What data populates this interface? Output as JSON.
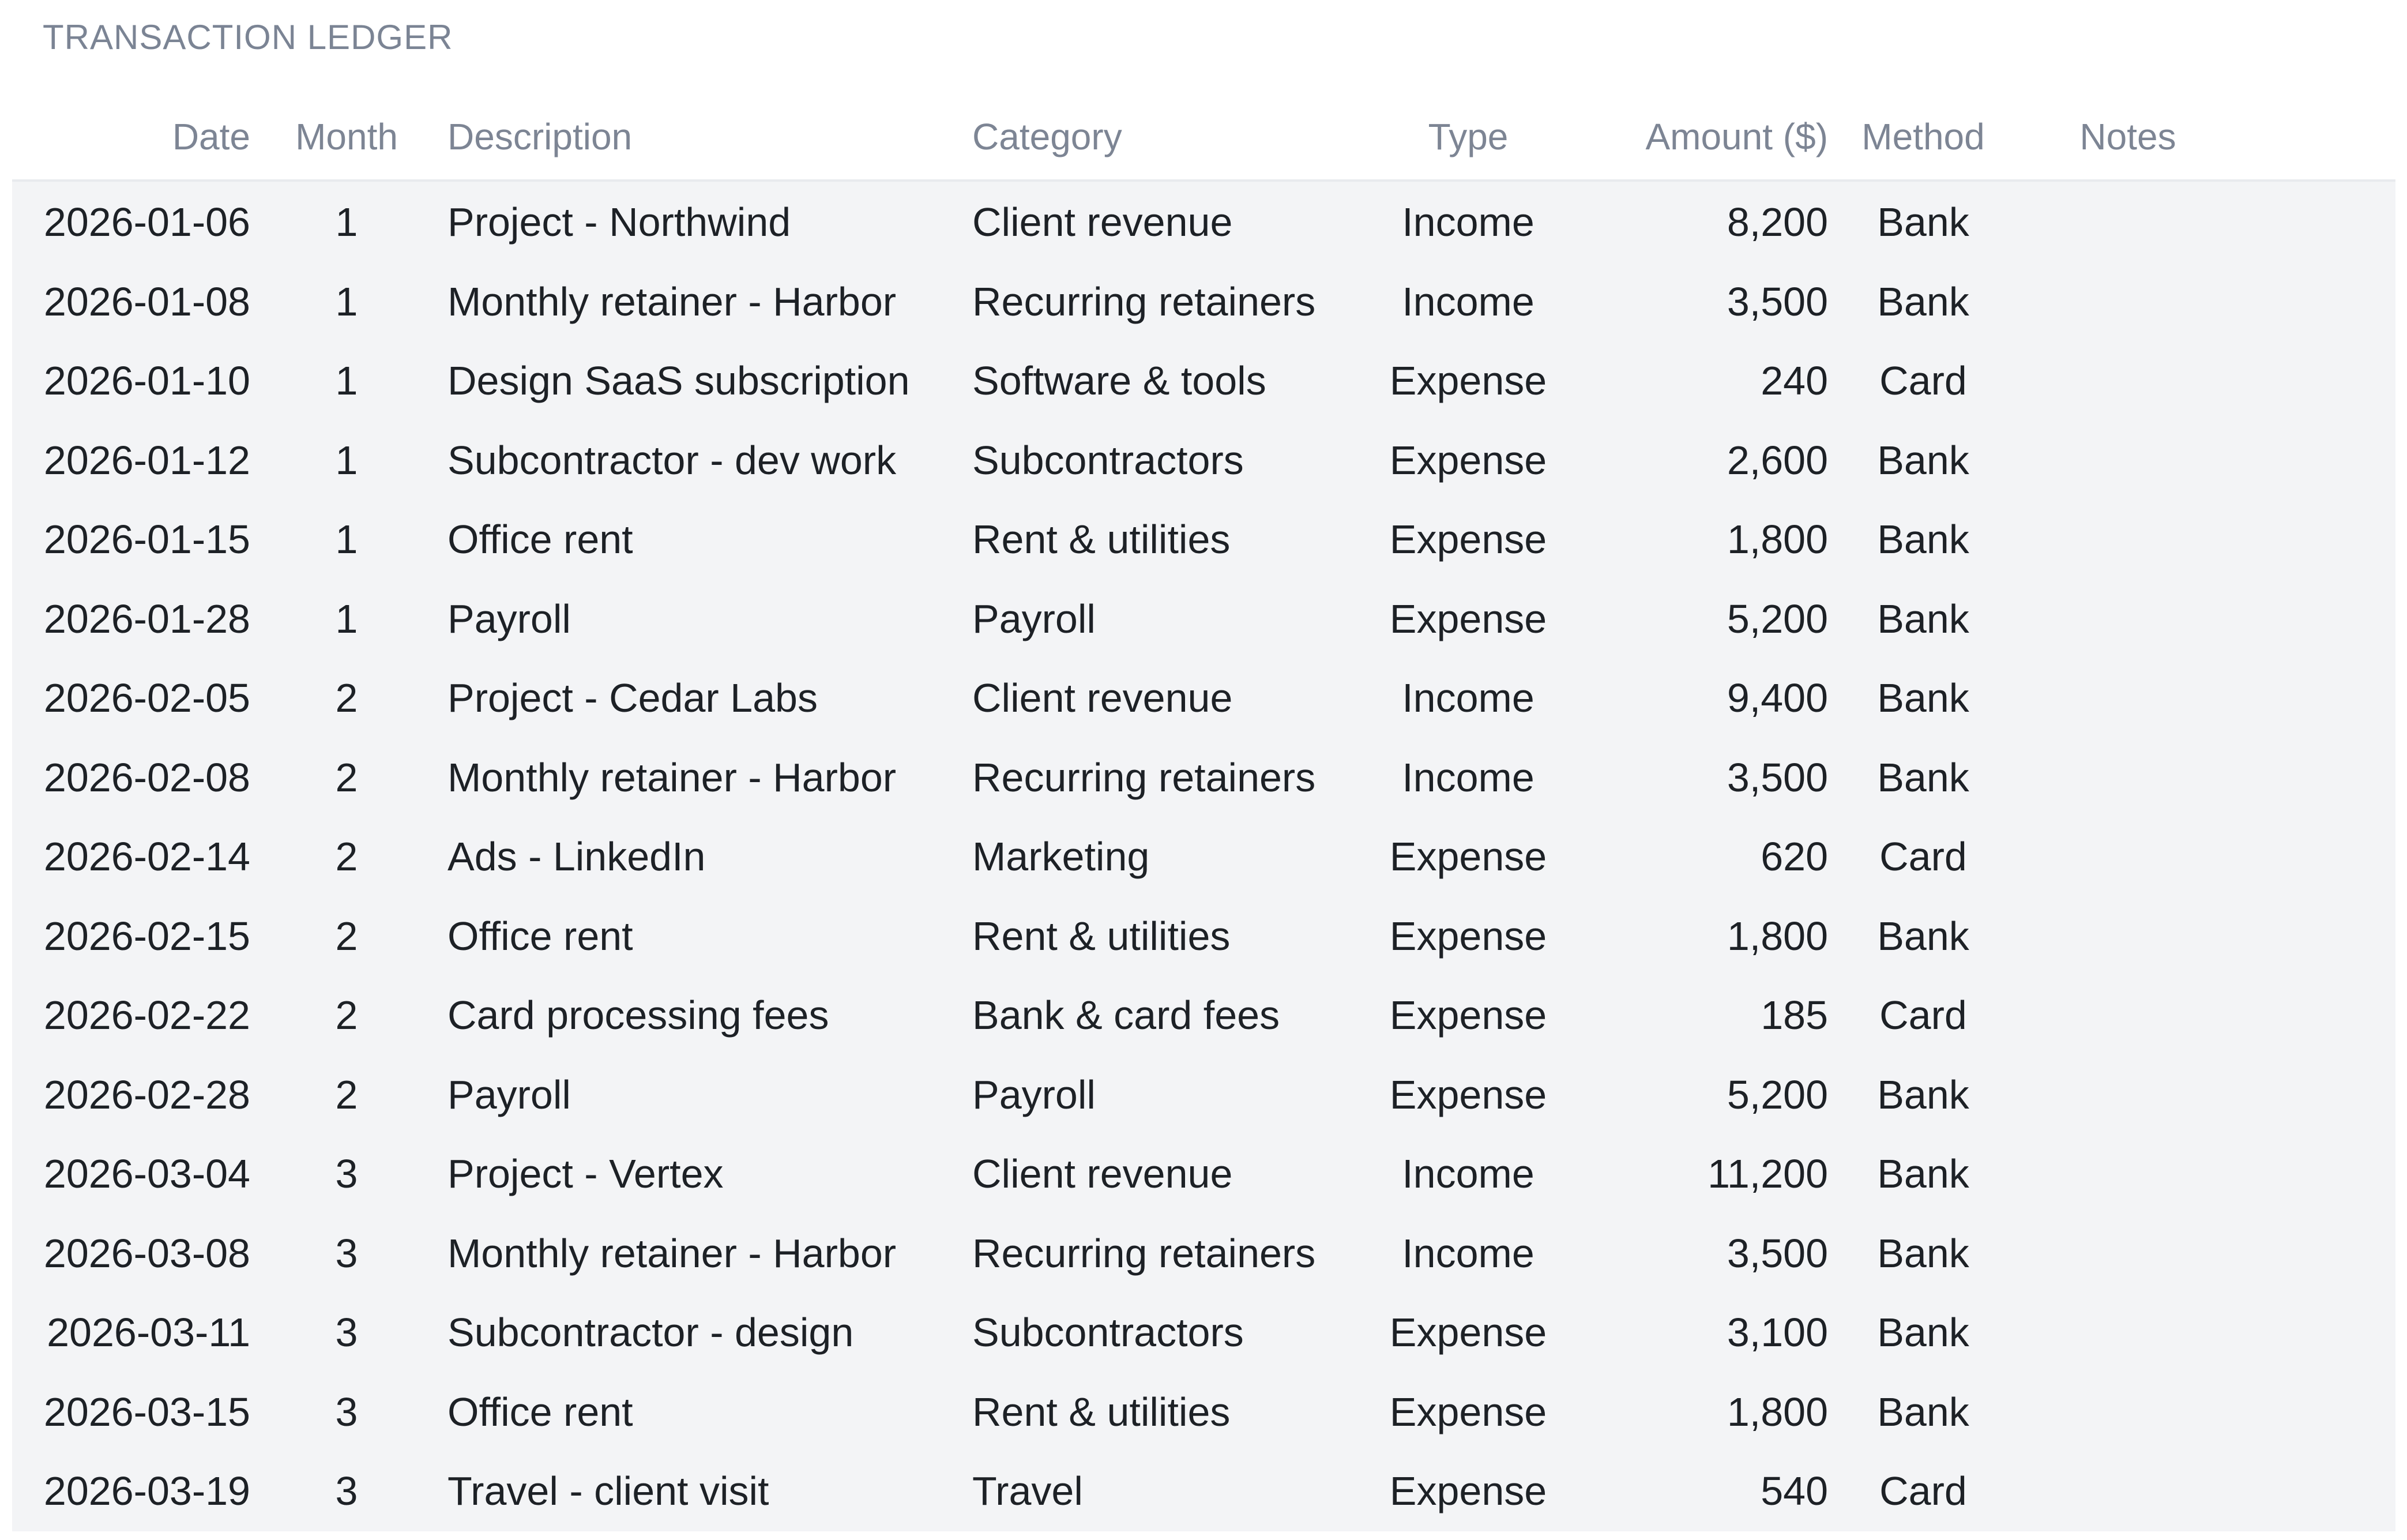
{
  "sheet": {
    "title": "TRANSACTION LEDGER"
  },
  "columns": {
    "date": "Date",
    "month": "Month",
    "description": "Description",
    "category": "Category",
    "type": "Type",
    "amount": "Amount ($)",
    "method": "Method",
    "notes": "Notes"
  },
  "rows": [
    {
      "date": "2026-01-06",
      "month": "1",
      "description": "Project - Northwind",
      "category": "Client revenue",
      "type": "Income",
      "amount": "8,200",
      "method": "Bank",
      "notes": ""
    },
    {
      "date": "2026-01-08",
      "month": "1",
      "description": "Monthly retainer - Harbor",
      "category": "Recurring retainers",
      "type": "Income",
      "amount": "3,500",
      "method": "Bank",
      "notes": ""
    },
    {
      "date": "2026-01-10",
      "month": "1",
      "description": "Design SaaS subscription",
      "category": "Software & tools",
      "type": "Expense",
      "amount": "240",
      "method": "Card",
      "notes": ""
    },
    {
      "date": "2026-01-12",
      "month": "1",
      "description": "Subcontractor - dev work",
      "category": "Subcontractors",
      "type": "Expense",
      "amount": "2,600",
      "method": "Bank",
      "notes": ""
    },
    {
      "date": "2026-01-15",
      "month": "1",
      "description": "Office rent",
      "category": "Rent & utilities",
      "type": "Expense",
      "amount": "1,800",
      "method": "Bank",
      "notes": ""
    },
    {
      "date": "2026-01-28",
      "month": "1",
      "description": "Payroll",
      "category": "Payroll",
      "type": "Expense",
      "amount": "5,200",
      "method": "Bank",
      "notes": ""
    },
    {
      "date": "2026-02-05",
      "month": "2",
      "description": "Project - Cedar Labs",
      "category": "Client revenue",
      "type": "Income",
      "amount": "9,400",
      "method": "Bank",
      "notes": ""
    },
    {
      "date": "2026-02-08",
      "month": "2",
      "description": "Monthly retainer - Harbor",
      "category": "Recurring retainers",
      "type": "Income",
      "amount": "3,500",
      "method": "Bank",
      "notes": ""
    },
    {
      "date": "2026-02-14",
      "month": "2",
      "description": "Ads - LinkedIn",
      "category": "Marketing",
      "type": "Expense",
      "amount": "620",
      "method": "Card",
      "notes": ""
    },
    {
      "date": "2026-02-15",
      "month": "2",
      "description": "Office rent",
      "category": "Rent & utilities",
      "type": "Expense",
      "amount": "1,800",
      "method": "Bank",
      "notes": ""
    },
    {
      "date": "2026-02-22",
      "month": "2",
      "description": "Card processing fees",
      "category": "Bank & card fees",
      "type": "Expense",
      "amount": "185",
      "method": "Card",
      "notes": ""
    },
    {
      "date": "2026-02-28",
      "month": "2",
      "description": "Payroll",
      "category": "Payroll",
      "type": "Expense",
      "amount": "5,200",
      "method": "Bank",
      "notes": ""
    },
    {
      "date": "2026-03-04",
      "month": "3",
      "description": "Project - Vertex",
      "category": "Client revenue",
      "type": "Income",
      "amount": "11,200",
      "method": "Bank",
      "notes": ""
    },
    {
      "date": "2026-03-08",
      "month": "3",
      "description": "Monthly retainer - Harbor",
      "category": "Recurring retainers",
      "type": "Income",
      "amount": "3,500",
      "method": "Bank",
      "notes": ""
    },
    {
      "date": "2026-03-11",
      "month": "3",
      "description": "Subcontractor - design",
      "category": "Subcontractors",
      "type": "Expense",
      "amount": "3,100",
      "method": "Bank",
      "notes": ""
    },
    {
      "date": "2026-03-15",
      "month": "3",
      "description": "Office rent",
      "category": "Rent & utilities",
      "type": "Expense",
      "amount": "1,800",
      "method": "Bank",
      "notes": ""
    },
    {
      "date": "2026-03-19",
      "month": "3",
      "description": "Travel - client visit",
      "category": "Travel",
      "type": "Expense",
      "amount": "540",
      "method": "Card",
      "notes": ""
    }
  ]
}
